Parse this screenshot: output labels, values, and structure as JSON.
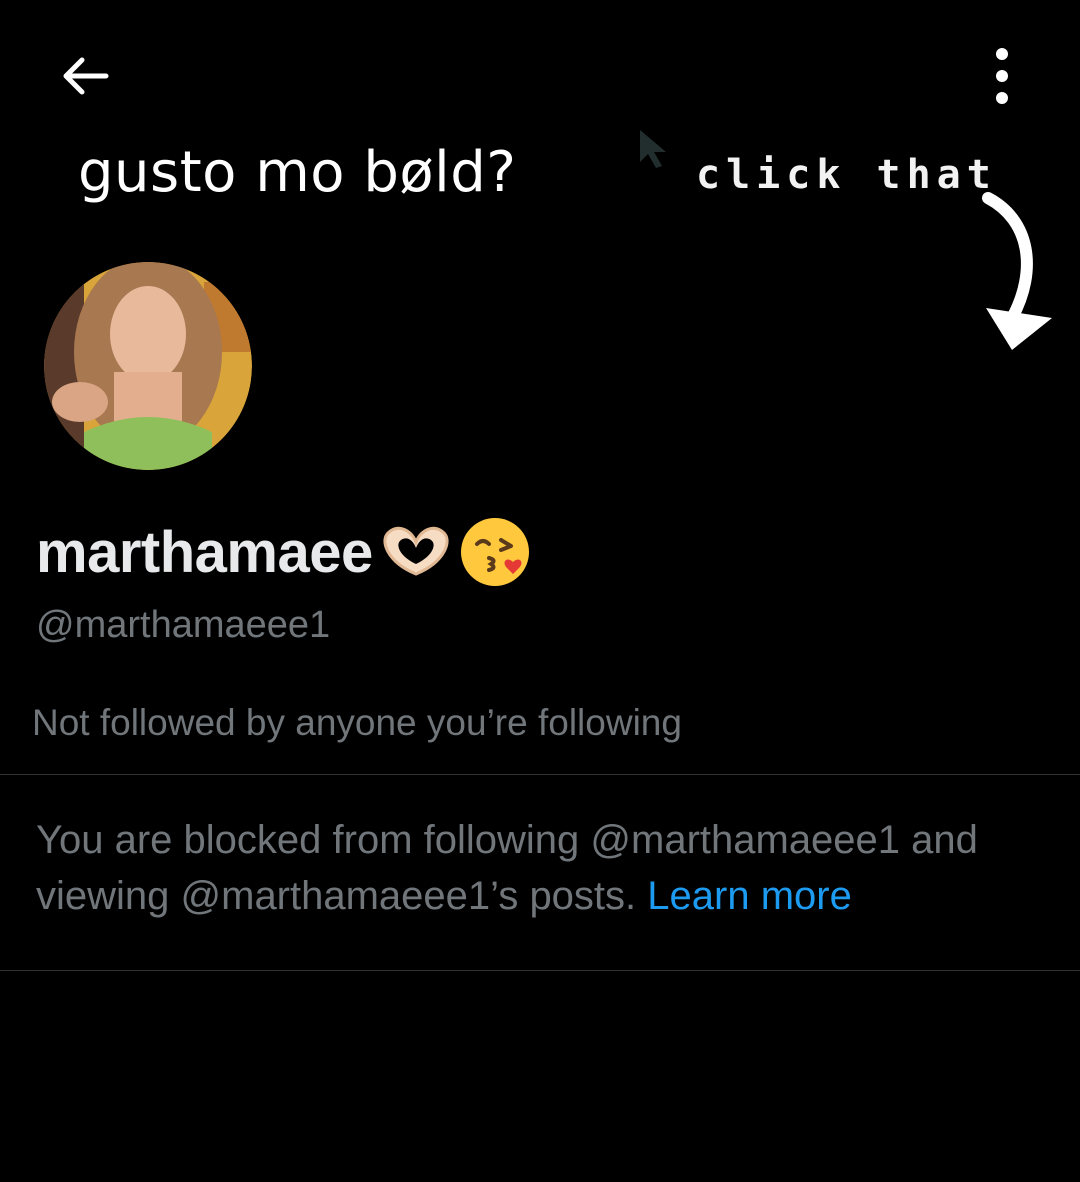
{
  "header": {
    "back_icon": "arrow-left-icon",
    "more_icon": "more-vertical-icon"
  },
  "banner": {
    "left_text": "gusto mo bøld?",
    "right_text": "click that",
    "arrow_icon": "curved-arrow-down-icon"
  },
  "profile": {
    "display_name": "marthamaee",
    "name_emojis": [
      "heart-hands-emoji",
      "kissing-face-emoji"
    ],
    "handle": "@marthamaeee1",
    "followed_by": "Not followed by anyone you’re following"
  },
  "blocked": {
    "message": "You are blocked from following @marthamaeee1 and viewing @marthamaeee1’s posts. ",
    "learn_more": "Learn more"
  },
  "colors": {
    "background": "#000000",
    "primary_text": "#e7e9ea",
    "secondary_text": "#71767b",
    "link": "#1d9bf0",
    "divider": "#2f3336"
  }
}
